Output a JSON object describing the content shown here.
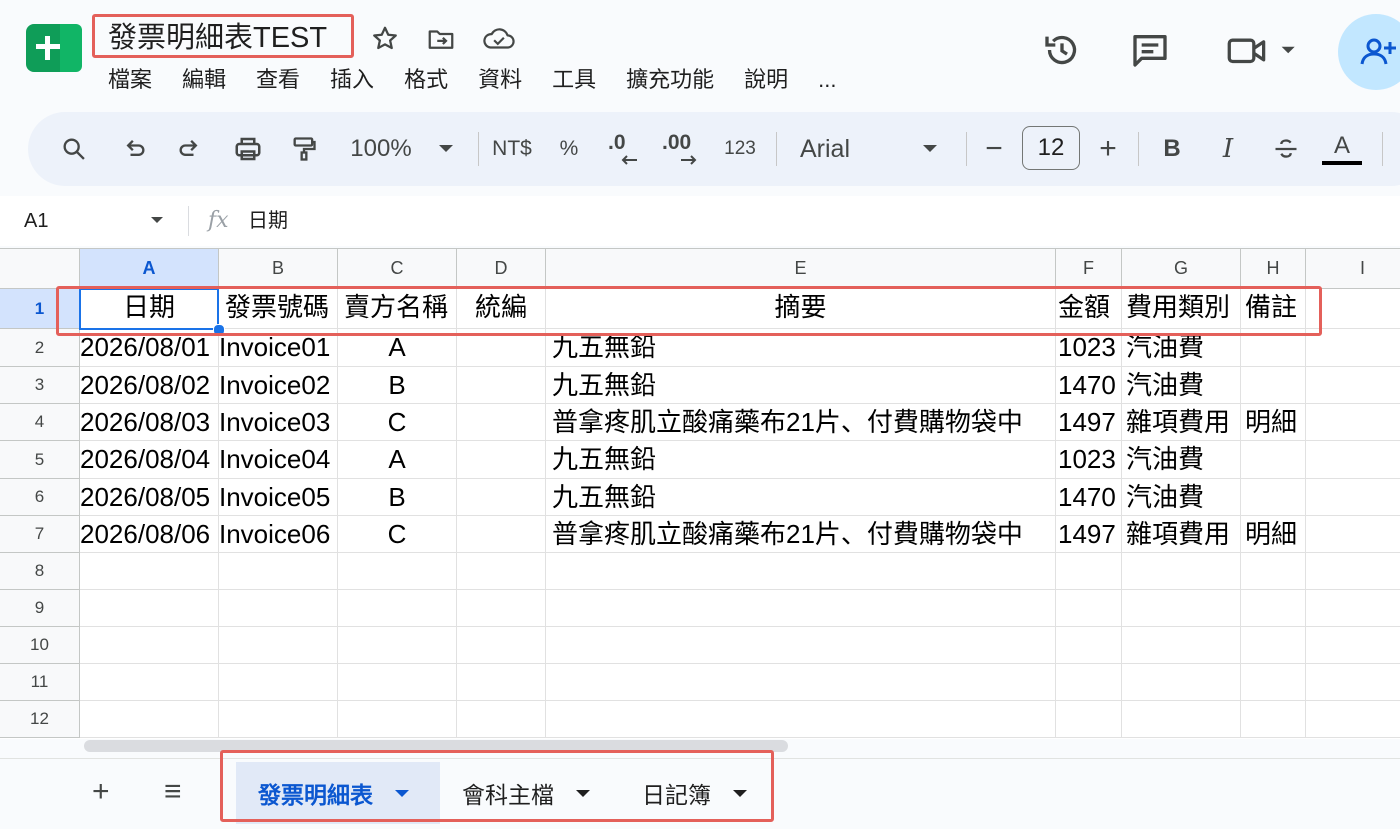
{
  "app": {
    "title": "發票明細表TEST"
  },
  "menu": [
    "檔案",
    "編輯",
    "查看",
    "插入",
    "格式",
    "資料",
    "工具",
    "擴充功能",
    "說明",
    "..."
  ],
  "toolbar": {
    "zoom": "100%",
    "currency": "NT$",
    "percent": "%",
    "decrease_decimal": ".0",
    "increase_decimal": ".00",
    "number_format": "123",
    "font": "Arial",
    "font_size": "12",
    "minus": "−",
    "plus": "+",
    "bold": "B",
    "italic": "I",
    "text_color": "A"
  },
  "formula_bar": {
    "cell_ref": "A1",
    "fx": "fx",
    "value": "日期"
  },
  "columns": [
    "A",
    "B",
    "C",
    "D",
    "E",
    "F",
    "G",
    "H",
    "I"
  ],
  "rows": [
    "1",
    "2",
    "3",
    "4",
    "5",
    "6",
    "7",
    "8",
    "9",
    "10",
    "11",
    "12"
  ],
  "sheet": {
    "header": [
      "日期",
      "發票號碼",
      "賣方名稱",
      "統編",
      "摘要",
      "金額",
      "費用類別",
      "備註"
    ],
    "data": [
      [
        "2026/08/01",
        "Invoice01",
        "A",
        "",
        "九五無鉛",
        "1023",
        "汽油費",
        ""
      ],
      [
        "2026/08/02",
        "Invoice02",
        "B",
        "",
        "九五無鉛",
        "1470",
        "汽油費",
        ""
      ],
      [
        "2026/08/03",
        "Invoice03",
        "C",
        "",
        "普拿疼肌立酸痛藥布21片、付費購物袋中",
        "1497",
        "雜項費用",
        "明細"
      ],
      [
        "2026/08/04",
        "Invoice04",
        "A",
        "",
        "九五無鉛",
        "1023",
        "汽油費",
        ""
      ],
      [
        "2026/08/05",
        "Invoice05",
        "B",
        "",
        "九五無鉛",
        "1470",
        "汽油費",
        ""
      ],
      [
        "2026/08/06",
        "Invoice06",
        "C",
        "",
        "普拿疼肌立酸痛藥布21片、付費購物袋中",
        "1497",
        "雜項費用",
        "明細"
      ]
    ]
  },
  "tabs": {
    "add": "+",
    "all_sheets": "≡",
    "items": [
      "發票明細表",
      "會科主檔",
      "日記簿"
    ]
  },
  "colors": {
    "accent": "#0b57d0",
    "highlight_box": "#e4605a",
    "selection": "#1a73e8",
    "logo": "#0f9d58"
  }
}
